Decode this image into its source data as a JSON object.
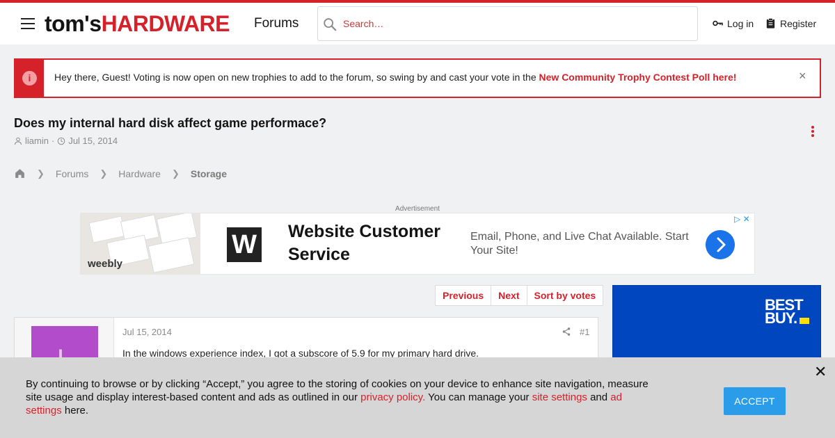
{
  "header": {
    "logo_part1": "tom's",
    "logo_part2": "HARDWARE",
    "forums_label": "Forums",
    "search_placeholder": "Search…",
    "login_label": "Log in",
    "register_label": "Register",
    "brand_color": "#d5222a"
  },
  "notice": {
    "text": "Hey there, Guest! Voting is now open on new trophies to add to the forum, so swing by and cast your vote in the ",
    "link_text": "New Community Trophy Contest Poll here!",
    "close_glyph": "×"
  },
  "thread": {
    "title": "Does my internal hard disk affect game performace?",
    "author": "liamin",
    "date": "Jul 15, 2014",
    "separator": "·"
  },
  "breadcrumb": {
    "items": [
      "Forums",
      "Hardware",
      "Storage"
    ]
  },
  "ad": {
    "label": "Advertisement",
    "brand": "weebly",
    "logo_letter": "W",
    "headline": "Website Customer Service",
    "description": "Email, Phone, and Live Chat Available. Start Your Site!"
  },
  "pagenav": {
    "previous": "Previous",
    "next": "Next",
    "sort": "Sort by votes"
  },
  "post": {
    "avatar_letter": "L",
    "date": "Jul 15, 2014",
    "number": "#1",
    "body": "In the windows experience index, I got a subscore of 5.9 for my primary hard drive."
  },
  "side_ad": {
    "brand_line1": "BEST",
    "brand_line2": "BUY."
  },
  "cookie": {
    "text1": "By continuing to browse or by clicking “Accept,” you agree to the storing of cookies on your device to enhance site navigation,  measure site usage and display interest-based content and ads as outlined in our ",
    "privacy_link": "privacy policy.",
    "text2": " You can manage your ",
    "settings_link": "site settings",
    "text3": " and ",
    "ad_settings_link": "ad settings",
    "text4": " here.",
    "accept_label": "ACCEPT",
    "close_glyph": "✕"
  }
}
